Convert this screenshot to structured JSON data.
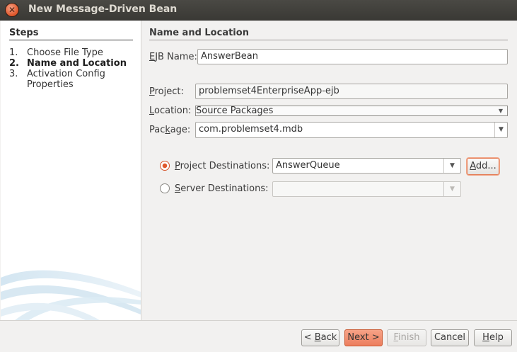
{
  "window": {
    "title": "New Message-Driven Bean",
    "close_glyph": "✕"
  },
  "steps": {
    "title": "Steps",
    "items": [
      {
        "num": "1.",
        "label": "Choose File Type"
      },
      {
        "num": "2.",
        "label": "Name and Location"
      },
      {
        "num": "3.",
        "label": "Activation Config Properties"
      }
    ],
    "current_index": 1
  },
  "main": {
    "title": "Name and Location",
    "ejb_name": {
      "label_u": "E",
      "label_rest": "JB Name:",
      "value": "AnswerBean"
    },
    "project": {
      "label_u": "P",
      "label_rest": "roject:",
      "value": "problemset4EnterpriseApp-ejb"
    },
    "location": {
      "label_u": "L",
      "label_rest": "ocation:",
      "value": "Source Packages"
    },
    "package": {
      "label_pre": "Pac",
      "label_u": "k",
      "label_rest": "age:",
      "value": "com.problemset4.mdb"
    },
    "project_destinations": {
      "label_u": "P",
      "label_rest": "roject Destinations:",
      "value": "AnswerQueue",
      "selected": true
    },
    "server_destinations": {
      "label_u": "S",
      "label_rest": "erver Destinations:",
      "value": "",
      "selected": false
    },
    "add_button": {
      "label_u": "A",
      "label_rest": "dd..."
    }
  },
  "footer": {
    "back": {
      "pre": "< ",
      "u": "B",
      "rest": "ack"
    },
    "next": "Next >",
    "finish": {
      "u": "F",
      "rest": "inish"
    },
    "cancel": "Cancel",
    "help": {
      "u": "H",
      "rest": "elp"
    }
  },
  "colors": {
    "accent": "#e0592d",
    "titlebar": "#3c3b37"
  }
}
